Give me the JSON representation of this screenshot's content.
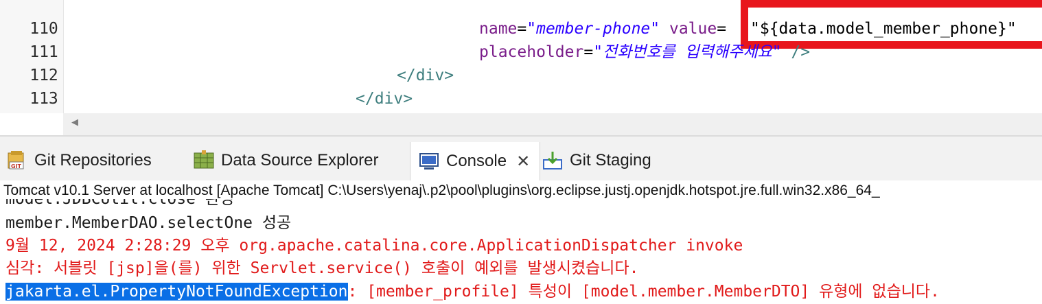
{
  "editor": {
    "lines": [
      {
        "num": "110",
        "attr": "name",
        "value": "\"member-phone\"",
        "attr2": "value",
        "value2": "\"${data.model_member_phone}\""
      },
      {
        "num": "111",
        "attr": "placeholder",
        "value": "\"전화번호를 입력해주세요\"",
        "end": " />"
      },
      {
        "num": "112",
        "code": "</div>"
      },
      {
        "num": "113",
        "code": "</div>"
      }
    ]
  },
  "tabs": [
    {
      "label": "Git Repositories",
      "icon": "git-repositories-icon"
    },
    {
      "label": "Data Source Explorer",
      "icon": "data-source-explorer-icon"
    },
    {
      "label": "Console",
      "icon": "console-icon",
      "active": true
    },
    {
      "label": "Git Staging",
      "icon": "git-staging-icon"
    }
  ],
  "console": {
    "header": "Tomcat v10.1 Server at localhost [Apache Tomcat] C:\\Users\\yenaj\\.p2\\pool\\plugins\\org.eclipse.justj.openjdk.hotspot.jre.full.win32.x86_64_",
    "line_partial": "model.JDBCUtil.close 완성",
    "line1": "member.MemberDAO.selectOne 성공",
    "line2": "9월 12, 2024 2:28:29 오후 org.apache.catalina.core.ApplicationDispatcher invoke",
    "line3": "심각: 서블릿 [jsp]을(를) 위한 Servlet.service() 호출이 예외를 발생시켰습니다.",
    "line4_selected": "jakarta.el.PropertyNotFoundException",
    "line4_rest": ": [member_profile] 특성이 [model.member.MemberDTO] 유형에 없습니다."
  },
  "colors": {
    "highlight_box": "#e8161c",
    "selection": "#0a6fe6",
    "error_text": "#e11a1a"
  }
}
